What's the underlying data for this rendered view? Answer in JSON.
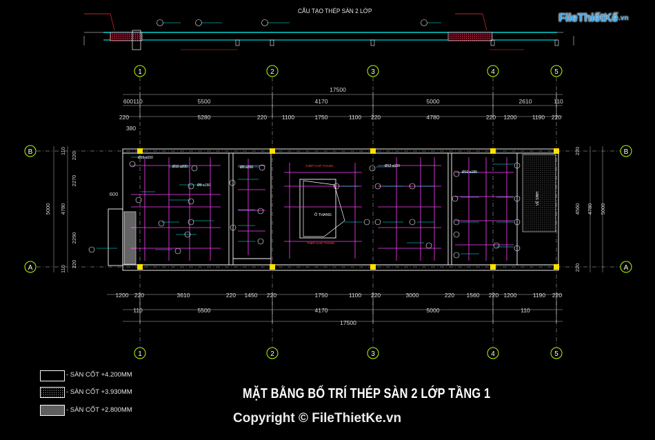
{
  "top_section_title": "CẤU TẠO THÉP SÀN 2 LỚP",
  "logo": {
    "brand": "FileThiếtKế",
    "tld": ".vn"
  },
  "grid": {
    "columns": [
      "1",
      "2",
      "3",
      "4",
      "5"
    ],
    "rows": [
      "A",
      "B"
    ]
  },
  "dimensions": {
    "top_overall": "17500",
    "top_row1": [
      "600",
      "110",
      "5500",
      "4170",
      "5000",
      "2610",
      "110"
    ],
    "top_row2": [
      "220",
      "5280",
      "220",
      "1100",
      "1750",
      "1100",
      "220",
      "4780",
      "220",
      "1200",
      "1190",
      "220"
    ],
    "top_row2_extra": "380",
    "left_side": [
      "110",
      "220",
      "2270",
      "4780",
      "2290",
      "220",
      "110",
      "600",
      "5000"
    ],
    "right_side": [
      "220",
      "4560",
      "4780",
      "5000",
      "220"
    ],
    "bottom_row1": [
      "1200",
      "220",
      "3610",
      "220",
      "1450",
      "220",
      "1750",
      "1100",
      "220",
      "3000",
      "220",
      "1560",
      "220",
      "1200",
      "1190",
      "220"
    ],
    "bottom_row2": [
      "110",
      "5500",
      "4170",
      "5000",
      "110"
    ],
    "bottom_overall": "17500"
  },
  "plan_labels": {
    "stair": "Ô THANG",
    "stair_note_top": "THÉP CHỜ THANG",
    "stair_note_bottom": "THÉP CHỜ THANG",
    "wc": "VỆ SINH"
  },
  "rebar_labels": [
    "Ø10 a150",
    "Ø10 a200",
    "Ø8 a150",
    "Ø8 a200",
    "Ø12 a150",
    "Ø10 a180"
  ],
  "legend": [
    {
      "label": "- SÀN CỐT +4.200MM",
      "pattern": "plain"
    },
    {
      "label": "- SÀN CỐT +3.930MM",
      "pattern": "dots"
    },
    {
      "label": "- SÀN CỐT +2.800MM",
      "pattern": "dense"
    }
  ],
  "main_title": "MẶT BẰNG BỐ TRÍ THÉP SÀN 2 LỚP TẦNG 1",
  "copyright": "Copyright © FileThietKe.vn",
  "colors": {
    "background": "#000000",
    "grid_bubble": "#b6ff00",
    "rebar": "#ff40ff",
    "rebar_label": "#00ffff",
    "column": "#ffe000",
    "wall": "#ffffff",
    "hatch_red": "#ff2b2b",
    "logo_blue": "#3aa6e8"
  }
}
